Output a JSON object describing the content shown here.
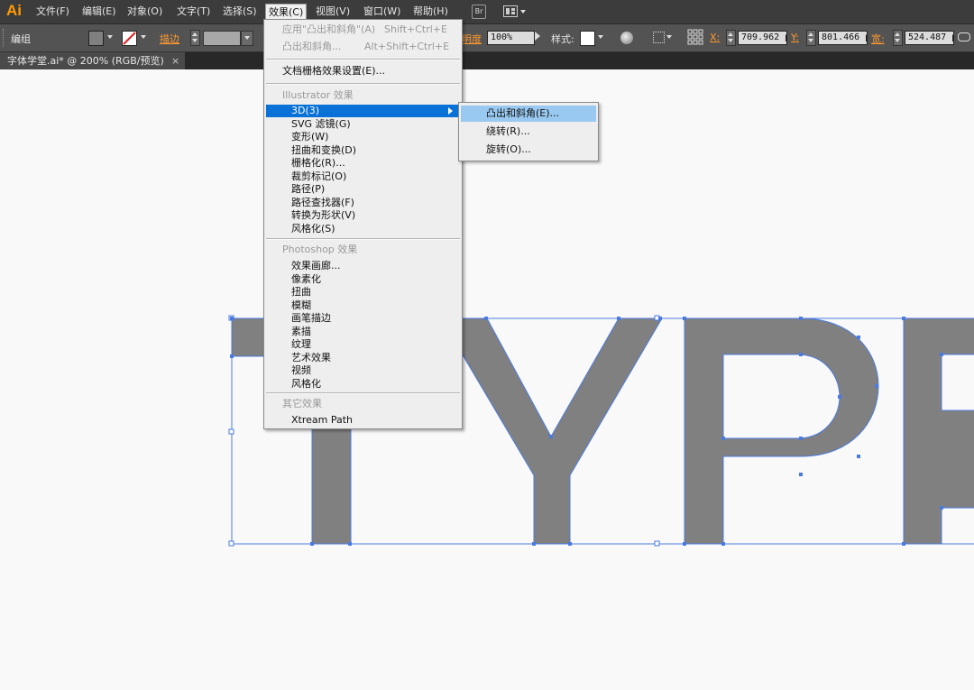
{
  "app": {
    "logo": "Ai"
  },
  "menubar": {
    "items": [
      "文件(F)",
      "编辑(E)",
      "对象(O)",
      "文字(T)",
      "选择(S)",
      "效果(C)",
      "视图(V)",
      "窗口(W)",
      "帮助(H)"
    ],
    "active_index": 5,
    "bridge_button": "Br"
  },
  "controlbar": {
    "selection_label": "编组",
    "stroke_label": "描边",
    "opacity_label": "明度",
    "opacity_value": "100%",
    "style_label": "样式:",
    "x_label": "X:",
    "x_value": "709.962 p",
    "y_label": "Y:",
    "y_value": "801.466 p",
    "w_label": "宽:",
    "w_value": "524.487 p"
  },
  "document_tab": {
    "title": "字体学堂.ai* @ 200% (RGB/预览)",
    "close": "×"
  },
  "effect_menu": {
    "apply_last": {
      "label": "应用\"凸出和斜角\"(A)",
      "shortcut": "Shift+Ctrl+E"
    },
    "last_effect": {
      "label": "凸出和斜角...",
      "shortcut": "Alt+Shift+Ctrl+E"
    },
    "doc_raster": "文档栅格效果设置(E)...",
    "illustrator_section": "Illustrator 效果",
    "illustrator_items": [
      "3D(3)",
      "SVG 滤镜(G)",
      "变形(W)",
      "扭曲和变换(D)",
      "栅格化(R)...",
      "裁剪标记(O)",
      "路径(P)",
      "路径查找器(F)",
      "转换为形状(V)",
      "风格化(S)"
    ],
    "highlighted_index": 0,
    "photoshop_section": "Photoshop 效果",
    "photoshop_items": [
      "效果画廊...",
      "像素化",
      "扭曲",
      "模糊",
      "画笔描边",
      "素描",
      "纹理",
      "艺术效果",
      "视频",
      "风格化"
    ],
    "other_section": "其它效果",
    "other_items": [
      "Xtream Path"
    ]
  },
  "submenu_3d": {
    "items": [
      "凸出和斜角(E)...",
      "绕转(R)...",
      "旋转(O)..."
    ],
    "highlighted_index": 0
  },
  "artwork": {
    "text": "TYPE",
    "fill_color": "#808080",
    "selection_color": "#4a7ae0"
  }
}
